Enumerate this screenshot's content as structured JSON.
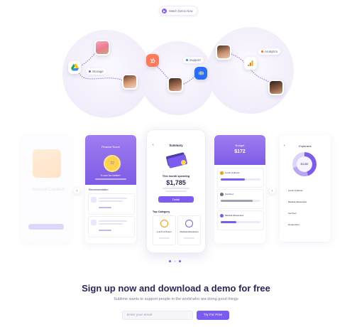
{
  "header": {
    "watch_label": "Watch Demo Now"
  },
  "hero": {
    "storage_chip": "Storage",
    "support_chip": "Support",
    "analytics_chip": "Analytics",
    "colors": {
      "purple": "#7c5cf0",
      "hubspot": "#ff7a59",
      "drive_green": "#1fa463",
      "drive_yellow": "#ffc107",
      "drive_blue": "#4285f4",
      "intercom": "#286efa",
      "analytics_orange": "#f9ab00"
    },
    "icons": [
      "google-drive-icon",
      "hubspot-icon",
      "intercom-icon",
      "google-analytics-icon"
    ]
  },
  "screens": {
    "account": {
      "title": "Account Created!"
    },
    "finance": {
      "title": "Finance Score",
      "score": "72",
      "subtitle": "It can be better!",
      "recommendation_label": "Recommendation"
    },
    "summary": {
      "title": "Summary",
      "month_label": "This month spending",
      "amount": "$1,785",
      "button": "Detail",
      "top_category": "Top Category",
      "categories": [
        "Lunch & Dinner",
        "Medical Allowances"
      ]
    },
    "budget": {
      "title": "Budget",
      "amount": "$172",
      "items": [
        "Lunch & Dinner",
        "Car Fuel",
        "Medical Allowances"
      ]
    },
    "expenses": {
      "title": "Expenses",
      "center_value": "$3,050",
      "items": [
        "Lunch & Dinner",
        "Medical Allowances",
        "Car Fuel",
        "House Rent"
      ]
    }
  },
  "pagination": {
    "count": 3,
    "active": 0
  },
  "cta": {
    "title": "Sign up now and download a demo for free",
    "subtitle": "Sublime wants to support people in the world who are doing good things",
    "email_placeholder": "Enter your email",
    "button": "Try For Free"
  }
}
